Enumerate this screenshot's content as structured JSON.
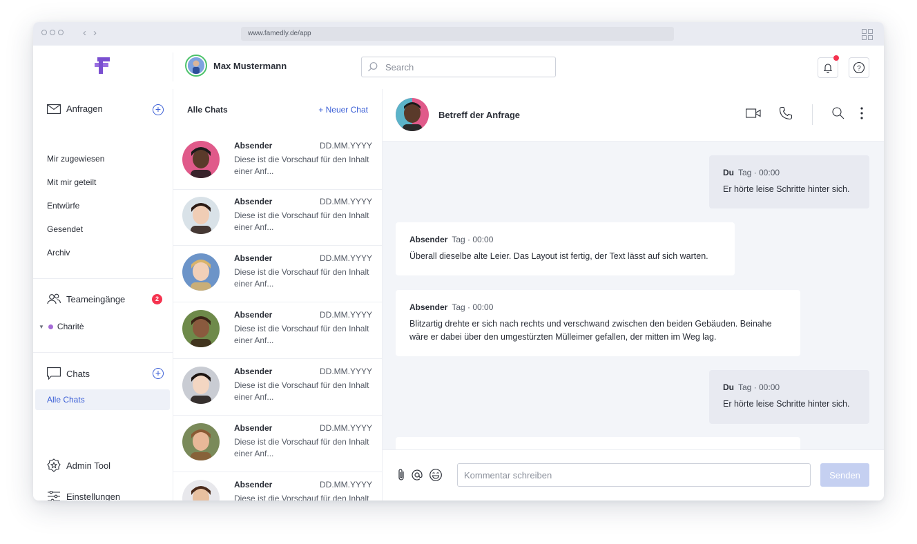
{
  "browser": {
    "url": "www.famedly.de/app"
  },
  "header": {
    "user_name": "Max Mustermann",
    "search_placeholder": "Search"
  },
  "sidebar": {
    "anfragen_label": "Anfragen",
    "anfragen_items": [
      {
        "label": "Mir zugewiesen"
      },
      {
        "label": "Mit mir geteilt"
      },
      {
        "label": "Entwürfe"
      },
      {
        "label": "Gesendet"
      },
      {
        "label": "Archiv"
      }
    ],
    "teams_label": "Teameingänge",
    "teams_badge": "2",
    "team_item": "Charitè",
    "chats_label": "Chats",
    "chats_active": "Alle Chats",
    "admin_label": "Admin Tool",
    "settings_label": "Einstellungen"
  },
  "chatlist": {
    "title": "Alle Chats",
    "new_chat": "+ Neuer Chat",
    "items": [
      {
        "sender": "Absender",
        "date": "DD.MM.YYYY",
        "preview": "Diese ist die Vorschauf für den Inhalt einer Anf...",
        "skin": "#5a3a2a",
        "bg": "#e05a8a",
        "hair": "#1a1a1a"
      },
      {
        "sender": "Absender",
        "date": "DD.MM.YYYY",
        "preview": "Diese ist die Vorschauf für den Inhalt einer Anf...",
        "skin": "#f0cdb5",
        "bg": "#d9e2e8",
        "hair": "#2a1a14"
      },
      {
        "sender": "Absender",
        "date": "DD.MM.YYYY",
        "preview": "Diese ist die Vorschauf für den Inhalt einer Anf...",
        "skin": "#f2d0b8",
        "bg": "#6c94c8",
        "hair": "#d9b36a"
      },
      {
        "sender": "Absender",
        "date": "DD.MM.YYYY",
        "preview": "Diese ist die Vorschauf für den Inhalt einer Anf...",
        "skin": "#8a5a3e",
        "bg": "#6e8a4a",
        "hair": "#3a2416"
      },
      {
        "sender": "Absender",
        "date": "DD.MM.YYYY",
        "preview": "Diese ist die Vorschauf für den Inhalt einer Anf...",
        "skin": "#f3d6c2",
        "bg": "#c9ccd3",
        "hair": "#1c1410"
      },
      {
        "sender": "Absender",
        "date": "DD.MM.YYYY",
        "preview": "Diese ist die Vorschauf für den Inhalt einer Anf...",
        "skin": "#e8b898",
        "bg": "#7a8a5a",
        "hair": "#8a5a34"
      },
      {
        "sender": "Absender",
        "date": "DD.MM.YYYY",
        "preview": "Diese ist die Vorschauf für den Inhalt einer Anf...",
        "skin": "#e8c0a0",
        "bg": "#e8e8ec",
        "hair": "#4a2a1a"
      }
    ]
  },
  "conversation": {
    "title": "Betreff der Anfrage",
    "messages": [
      {
        "own": true,
        "author": "Du",
        "time": "Tag · 00:00",
        "text": "Er hörte leise Schritte hinter sich."
      },
      {
        "own": false,
        "author": "Absender",
        "time": "Tag · 00:00",
        "text": "Überall dieselbe alte Leier. Das Layout ist fertig, der Text lässt auf sich warten."
      },
      {
        "own": false,
        "author": "Absender",
        "time": "Tag · 00:00",
        "text": "Blitzartig drehte er sich nach rechts und verschwand zwischen den beiden Gebäuden. Beinahe wäre er dabei über den umgestürzten Mülleimer gefallen, der mitten im Weg lag."
      },
      {
        "own": true,
        "author": "Du",
        "time": "Tag · 00:00",
        "text": "Er hörte leise Schritte hinter sich."
      }
    ],
    "composer_placeholder": "Kommentar schreiben",
    "send_label": "Senden"
  },
  "colors": {
    "accent": "#3b5fd6",
    "logo": "#7a4fd0",
    "badge": "#f5334f",
    "online": "#4cc26a",
    "team_dot": "#a56bd6"
  }
}
